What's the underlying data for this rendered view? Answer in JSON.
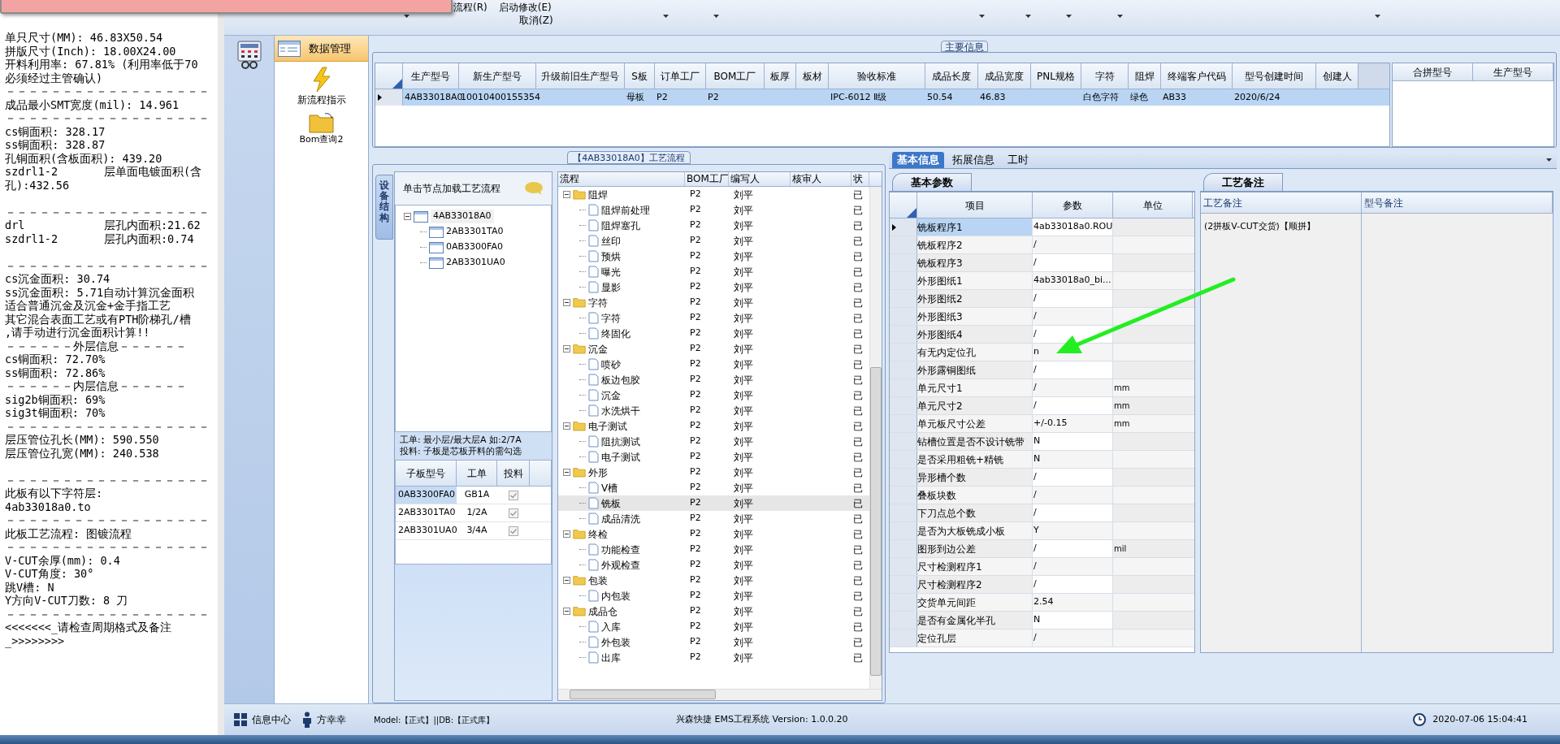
{
  "report": {
    "blocks": [
      [
        "单只尺寸(MM): 46.83X50.54",
        "拼版尺寸(Inch): 18.00X24.00",
        "开料利用率: 67.81% (利用率低于70",
        "必须经过主管确认)",
        "－－－－－－－－－－－－－－－－－－",
        "成品最小SMT宽度(mil): 14.961",
        "－－－－－－－－－－－－－－－－－－",
        "cs铜面积: 328.17",
        "ss铜面积: 328.87",
        "孔铜面积(含板面积): 439.20",
        "szdrl1-2       层单面电镀面积(含",
        "孔):432.56"
      ],
      [
        "－－－－－－－－－－－－－－－－－－",
        "drl            层孔内面积:21.62",
        "szdrl1-2       层孔内面积:0.74"
      ],
      [
        "－－－－－－－－－－－－－－－－－－",
        "cs沉金面积: 30.74",
        "ss沉金面积: 5.71自动计算沉金面积",
        "适合普通沉金及沉金+金手指工艺",
        "其它混合表面工艺或有PTH阶梯孔/槽",
        ",请手动进行沉金面积计算!!",
        "－－－－－－外层信息－－－－－－",
        "cs铜面积: 72.70%",
        "ss铜面积: 72.86%",
        "－－－－－－内层信息－－－－－－",
        "sig2b铜面积: 69%",
        "sig3t铜面积: 70%",
        "－－－－－－－－－－－－－－－－－－",
        "层压管位孔长(MM): 590.550",
        "层压管位孔宽(MM): 240.538"
      ],
      [
        "－－－－－－－－－－－－－－－－－－",
        "此板有以下字符层:",
        "4ab33018a0.to",
        "－－－－－－－－－－－－－－－－－－",
        "此板工艺流程: 图镀流程",
        "－－－－－－－－－－－－－－－－－－",
        "V-CUT余厚(mm): 0.4",
        "V-CUT角度: 30°",
        "跳V槽: N",
        "Y方向V-CUT刀数: 8 刀",
        "－－－－－－－－－－－－－－－－－－",
        "<<<<<<<_请检查周期格式及备注",
        "_>>>>>>>>"
      ]
    ]
  },
  "ribbon": {
    "top": [
      "流程(R)",
      "启动修改(E)"
    ],
    "bottom": [
      "取消(Z)"
    ]
  },
  "nav": {
    "header": "数据管理",
    "items": [
      {
        "kind": "lightning",
        "label": "新流程指示"
      },
      {
        "kind": "folder",
        "label": "Bom查询2"
      }
    ]
  },
  "main_info": {
    "title": "主要信息",
    "columns": [
      "生产型号",
      "新生产型号",
      "升级前旧生产型号",
      "S板",
      "订单工厂",
      "BOM工厂",
      "板厚",
      "板材",
      "验收标准",
      "成品长度",
      "成品宽度",
      "PNL规格",
      "字符",
      "阻焊",
      "终端客户代码",
      "型号创建时间",
      "创建人"
    ],
    "rows": [
      {
        "selected": true,
        "cells": [
          "4AB33018A0",
          "10010400155354",
          null,
          "母板",
          "P2",
          "P2",
          null,
          null,
          "IPC-6012 Ⅱ级",
          "50.54",
          "46.83",
          null,
          "白色字符",
          "绿色",
          "AB33",
          "2020/6/24",
          null
        ]
      }
    ],
    "side_columns": [
      "合拼型号",
      "生产型号"
    ]
  },
  "process": {
    "title": "【4AB33018A0】工艺流程",
    "side_tab": "设备结构",
    "hint": "单击节点加载工艺流程",
    "board_tree": {
      "name": "4AB33018A0",
      "expanded": true,
      "children": [
        {
          "name": "2AB3301TA0"
        },
        {
          "name": "0AB3300FA0"
        },
        {
          "name": "2AB3301UA0"
        }
      ]
    },
    "notes": [
      "工单: 最小层/最大层A 如:2/7A",
      "投料: 子板是芯板开料的需勾选"
    ],
    "sub_table": {
      "columns": [
        "子板型号",
        "工单",
        "投料"
      ],
      "rows": [
        {
          "model": "0AB3300FA0",
          "order": "GB1A",
          "checked": true,
          "selected": true
        },
        {
          "model": "2AB3301TA0",
          "order": "1/2A",
          "checked": true,
          "selected": false
        },
        {
          "model": "2AB3301UA0",
          "order": "3/4A",
          "checked": true,
          "selected": false
        }
      ]
    },
    "flow": {
      "columns": [
        "流程",
        "BOM工厂",
        "编写人",
        "核审人",
        "状"
      ],
      "rows": [
        {
          "name": "阻焊",
          "bom": "P2",
          "writer": "刘平",
          "status": "已",
          "selected": false,
          "expanded": true,
          "children": [
            {
              "name": "阻焊前处理",
              "bom": "P2",
              "writer": "刘平",
              "status": "已",
              "selected": false
            },
            {
              "name": "阻焊塞孔",
              "bom": "P2",
              "writer": "刘平",
              "status": "已",
              "selected": false
            },
            {
              "name": "丝印",
              "bom": "P2",
              "writer": "刘平",
              "status": "已",
              "selected": false
            },
            {
              "name": "预烘",
              "bom": "P2",
              "writer": "刘平",
              "status": "已",
              "selected": false
            },
            {
              "name": "曝光",
              "bom": "P2",
              "writer": "刘平",
              "status": "已",
              "selected": false
            },
            {
              "name": "显影",
              "bom": "P2",
              "writer": "刘平",
              "status": "已",
              "selected": false
            }
          ]
        },
        {
          "name": "字符",
          "bom": "P2",
          "writer": "刘平",
          "status": "已",
          "selected": false,
          "expanded": true,
          "children": [
            {
              "name": "字符",
              "bom": "P2",
              "writer": "刘平",
              "status": "已",
              "selected": false
            },
            {
              "name": "终固化",
              "bom": "P2",
              "writer": "刘平",
              "status": "已",
              "selected": false
            }
          ]
        },
        {
          "name": "沉金",
          "bom": "P2",
          "writer": "刘平",
          "status": "已",
          "selected": false,
          "expanded": true,
          "children": [
            {
              "name": "喷砂",
              "bom": "P2",
              "writer": "刘平",
              "status": "已",
              "selected": false
            },
            {
              "name": "板边包胶",
              "bom": "P2",
              "writer": "刘平",
              "status": "已",
              "selected": false
            },
            {
              "name": "沉金",
              "bom": "P2",
              "writer": "刘平",
              "status": "已",
              "selected": false
            },
            {
              "name": "水洗烘干",
              "bom": "P2",
              "writer": "刘平",
              "status": "已",
              "selected": false
            }
          ]
        },
        {
          "name": "电子测试",
          "bom": "P2",
          "writer": "刘平",
          "status": "已",
          "selected": false,
          "expanded": true,
          "children": [
            {
              "name": "阻抗测试",
              "bom": "P2",
              "writer": "刘平",
              "status": "已",
              "selected": false
            },
            {
              "name": "电子测试",
              "bom": "P2",
              "writer": "刘平",
              "status": "已",
              "selected": false
            }
          ]
        },
        {
          "name": "外形",
          "bom": "P2",
          "writer": "刘平",
          "status": "已",
          "selected": false,
          "expanded": true,
          "children": [
            {
              "name": "V槽",
              "bom": "P2",
              "writer": "刘平",
              "status": "已",
              "selected": false
            },
            {
              "name": "铣板",
              "bom": "P2",
              "writer": "刘平",
              "status": "已",
              "selected": true
            },
            {
              "name": "成品清洗",
              "bom": "P2",
              "writer": "刘平",
              "status": "已",
              "selected": false
            }
          ]
        },
        {
          "name": "终检",
          "bom": "P2",
          "writer": "刘平",
          "status": "已",
          "selected": false,
          "expanded": true,
          "children": [
            {
              "name": "功能检查",
              "bom": "P2",
              "writer": "刘平",
              "status": "已",
              "selected": false
            },
            {
              "name": "外观检查",
              "bom": "P2",
              "writer": "刘平",
              "status": "已",
              "selected": false
            }
          ]
        },
        {
          "name": "包装",
          "bom": "P2",
          "writer": "刘平",
          "status": "已",
          "selected": false,
          "expanded": true,
          "children": [
            {
              "name": "内包装",
              "bom": "P2",
              "writer": "刘平",
              "status": "已",
              "selected": false
            }
          ]
        },
        {
          "name": "成品仓",
          "bom": "P2",
          "writer": "刘平",
          "status": "已",
          "selected": false,
          "expanded": true,
          "children": [
            {
              "name": "入库",
              "bom": "P2",
              "writer": "刘平",
              "status": "已",
              "selected": false
            },
            {
              "name": "外包装",
              "bom": "P2",
              "writer": "刘平",
              "status": "已",
              "selected": false
            },
            {
              "name": "出库",
              "bom": "P2",
              "writer": "刘平",
              "status": "已",
              "selected": false
            }
          ]
        }
      ]
    }
  },
  "details": {
    "tabs": [
      {
        "label": "基本信息",
        "selected": true
      },
      {
        "label": "拓展信息",
        "selected": false
      },
      {
        "label": "工时",
        "selected": false
      }
    ],
    "params": {
      "title": "基本参数",
      "columns": [
        "项目",
        "参数",
        "单位"
      ],
      "rows": [
        {
          "item": "铣板程序1",
          "value": "4ab33018a0.ROU",
          "selected": true
        },
        {
          "item": "铣板程序2",
          "value": "/",
          "selected": false
        },
        {
          "item": "铣板程序3",
          "value": "/",
          "selected": false
        },
        {
          "item": "外形图纸1",
          "value": "4ab33018a0_bi...",
          "selected": false
        },
        {
          "item": "外形图纸2",
          "value": "/",
          "selected": false
        },
        {
          "item": "外形图纸3",
          "value": "/",
          "selected": false
        },
        {
          "item": "外形图纸4",
          "value": "/",
          "selected": false
        },
        {
          "item": "有无内定位孔",
          "value": "n",
          "selected": false
        },
        {
          "item": "外形露铜图纸",
          "value": "/",
          "selected": false
        },
        {
          "item": "单元尺寸1",
          "value": "/",
          "unit": "mm",
          "selected": false
        },
        {
          "item": "单元尺寸2",
          "value": "/",
          "unit": "mm",
          "selected": false
        },
        {
          "item": "单元板尺寸公差",
          "value": "+/-0.15",
          "unit": "mm",
          "selected": false
        },
        {
          "item": "钻槽位置是否不设计铣带",
          "value": "N",
          "selected": false
        },
        {
          "item": "是否采用粗铣+精铣",
          "value": "N",
          "selected": false
        },
        {
          "item": "异形槽个数",
          "value": "/",
          "selected": false
        },
        {
          "item": "叠板块数",
          "value": "/",
          "selected": false
        },
        {
          "item": "下刀点总个数",
          "value": "/",
          "selected": false
        },
        {
          "item": "是否为大板铣成小板",
          "value": "Y",
          "selected": false
        },
        {
          "item": "图形到边公差",
          "value": "/",
          "unit": "mil",
          "selected": false
        },
        {
          "item": "尺寸检测程序1",
          "value": "/",
          "selected": false
        },
        {
          "item": "尺寸检测程序2",
          "value": "/",
          "selected": false
        },
        {
          "item": "交货单元间距",
          "value": "2.54",
          "selected": false
        },
        {
          "item": "是否有金属化半孔",
          "value": "N",
          "selected": false
        },
        {
          "item": "定位孔层",
          "value": "/",
          "selected": false
        }
      ]
    },
    "remarks": {
      "title": "工艺备注",
      "columns": [
        "工艺备注",
        "型号备注"
      ],
      "text": "(2拼板V-CUT交货)【顺拼】"
    }
  },
  "status_bar": {
    "module": "信息中心",
    "user": "方幸幸",
    "model": "Model:【正式】||DB:【正式库】",
    "title": "兴森快捷 EMS工程系统 Version: 1.0.0.20",
    "datetime": "2020-07-06 15:04:41"
  }
}
